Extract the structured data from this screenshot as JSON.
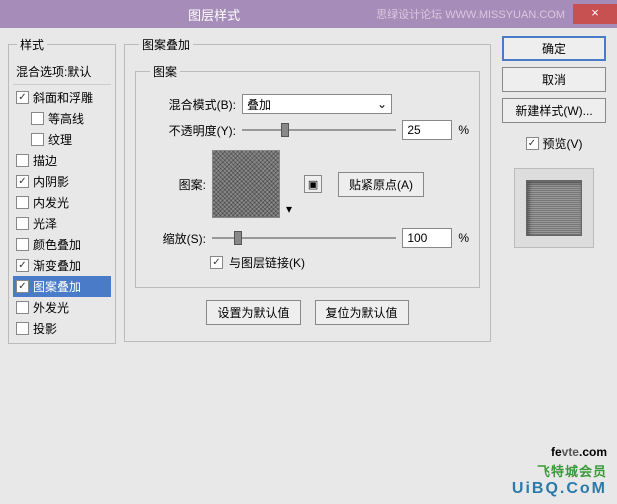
{
  "title": "图层样式",
  "watermark": "思绿设计论坛 WWW.MISSYUAN.COM",
  "styles": {
    "legend": "样式",
    "blend_defaults": "混合选项:默认",
    "items": [
      {
        "label": "斜面和浮雕",
        "checked": true,
        "indent": false,
        "selected": false
      },
      {
        "label": "等高线",
        "checked": false,
        "indent": true,
        "selected": false
      },
      {
        "label": "纹理",
        "checked": false,
        "indent": true,
        "selected": false
      },
      {
        "label": "描边",
        "checked": false,
        "indent": false,
        "selected": false
      },
      {
        "label": "内阴影",
        "checked": true,
        "indent": false,
        "selected": false
      },
      {
        "label": "内发光",
        "checked": false,
        "indent": false,
        "selected": false
      },
      {
        "label": "光泽",
        "checked": false,
        "indent": false,
        "selected": false
      },
      {
        "label": "颜色叠加",
        "checked": false,
        "indent": false,
        "selected": false
      },
      {
        "label": "渐变叠加",
        "checked": true,
        "indent": false,
        "selected": false
      },
      {
        "label": "图案叠加",
        "checked": true,
        "indent": false,
        "selected": true
      },
      {
        "label": "外发光",
        "checked": false,
        "indent": false,
        "selected": false
      },
      {
        "label": "投影",
        "checked": false,
        "indent": false,
        "selected": false
      }
    ]
  },
  "center": {
    "legend": "图案叠加",
    "sub_legend": "图案",
    "blend_mode_label": "混合模式(B):",
    "blend_mode_value": "叠加",
    "opacity_label": "不透明度(Y):",
    "opacity_value": "25",
    "pct": "%",
    "pattern_label": "图案:",
    "snap_label": "贴紧原点(A)",
    "scale_label": "缩放(S):",
    "scale_value": "100",
    "link_label": "与图层链接(K)",
    "set_default": "设置为默认值",
    "reset_default": "复位为默认值"
  },
  "right": {
    "ok": "确定",
    "cancel": "取消",
    "new_style": "新建样式(W)...",
    "preview": "预览(V)"
  },
  "logo": {
    "l1a": "fe",
    "l1b": "vte",
    "l1c": ".com",
    "l2": "飞特城会员",
    "l3": "UiBQ.CoM"
  }
}
